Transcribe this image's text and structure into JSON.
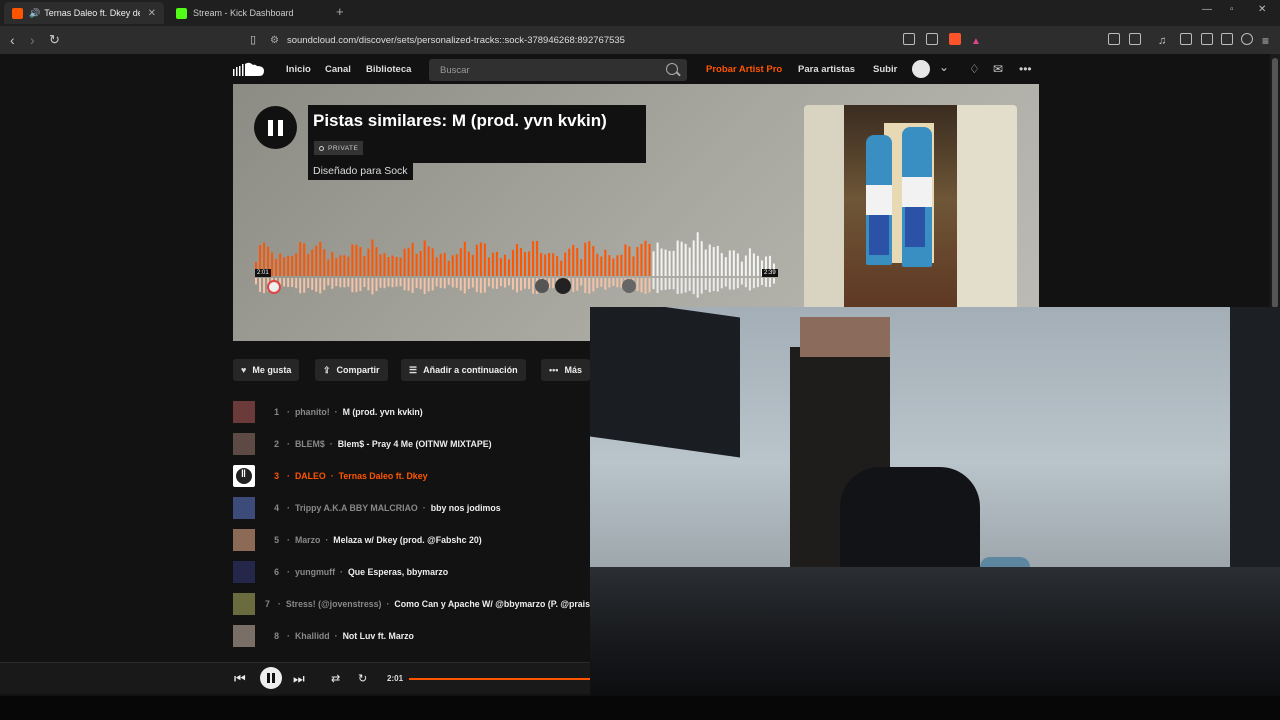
{
  "browser": {
    "tabs": [
      {
        "label": "Ternas Daleo ft. Dkey de DAL",
        "active": true,
        "favicon_color": "#ff5500"
      },
      {
        "label": "Stream - Kick Dashboard",
        "active": false,
        "favicon_color": "#53fc18"
      }
    ],
    "url": "soundcloud.com/discover/sets/personalized-tracks::sock-378946268:892767535"
  },
  "header": {
    "nav": [
      "Inicio",
      "Canal",
      "Biblioteca"
    ],
    "search_placeholder": "Buscar",
    "pro_link": "Probar Artist Pro",
    "for_artists": "Para artistas",
    "upload": "Subir",
    "accent_color": "#ff5500"
  },
  "hero": {
    "title": "Pistas similares: M (prod. yvn kvkin)",
    "private_badge": "PRIVATE",
    "made_for": "Diseñado para Sock",
    "wave_left_time": "2:01",
    "wave_right_time": "2:39",
    "progress_fraction": 0.76
  },
  "actions": {
    "like": "Me gusta",
    "share": "Compartir",
    "add_next": "Añadir a continuación",
    "more": "Más"
  },
  "tracks": [
    {
      "num": "1",
      "artist": "phanito!",
      "title": "M (prod. yvn kvkin)",
      "current": false,
      "thumb": "#6b3b3b"
    },
    {
      "num": "2",
      "artist": "BLEM$",
      "title": "Blem$ - Pray 4 Me (OITNW MIXTAPE)",
      "current": false,
      "thumb": "#5e4a44"
    },
    {
      "num": "3",
      "artist": "DALEO",
      "title": "Ternas Daleo ft. Dkey",
      "current": true,
      "thumb": "#ffffff"
    },
    {
      "num": "4",
      "artist": "Trippy A.K.A BBY MALCRIAO",
      "title": "bby nos jodimos",
      "current": false,
      "thumb": "#3c4b7a"
    },
    {
      "num": "5",
      "artist": "Marzo",
      "title": "Melaza w/ Dkey (prod. @Fabshc 20)",
      "current": false,
      "thumb": "#8c6a55"
    },
    {
      "num": "6",
      "artist": "yungmuff",
      "title": "Que Esperas, bbymarzo",
      "current": false,
      "thumb": "#24264a"
    },
    {
      "num": "7",
      "artist": "Stress! (@jovenstress)",
      "title": "Como Can y Apache W/ @bbymarzo (P. @praiset",
      "current": false,
      "thumb": "#6b6b40"
    },
    {
      "num": "8",
      "artist": "Khallidd",
      "title": "Not Luv ft. Marzo",
      "current": false,
      "thumb": "#7a6f66"
    }
  ],
  "playbar": {
    "time": "2:01"
  }
}
